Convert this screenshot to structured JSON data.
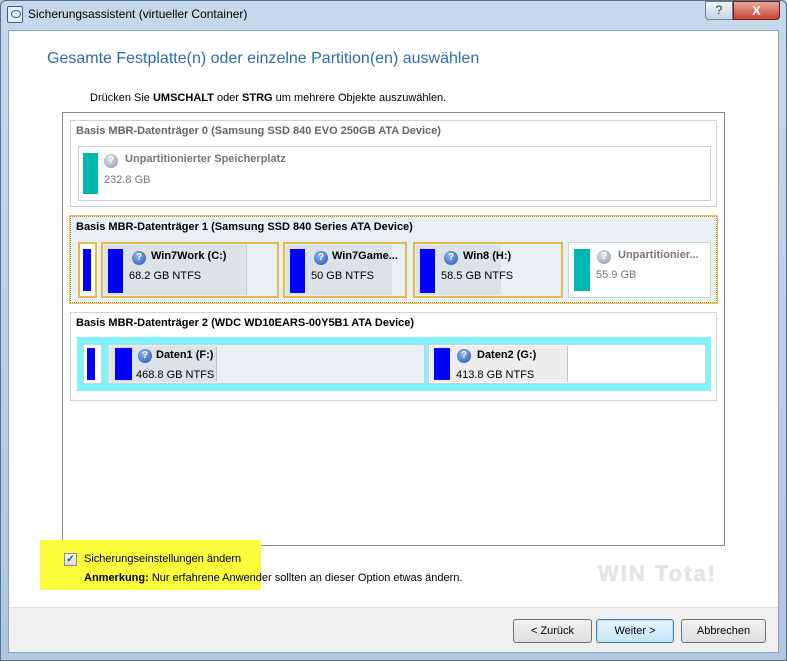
{
  "window": {
    "title": "Sicherungsassistent (virtueller Container)",
    "help": "?",
    "close": "X"
  },
  "heading": "Gesamte Festplatte(n) oder einzelne Partition(en) auswählen",
  "instruction": {
    "pre": "Drücken Sie ",
    "k1": "UMSCHALT",
    "mid": " oder ",
    "k2": "STRG",
    "post": " um mehrere Objekte auszuwählen."
  },
  "disks": [
    {
      "header": "Basis MBR-Datenträger 0 (Samsung SSD 840 EVO 250GB ATA Device)",
      "partitions": [
        {
          "name": "Unpartitionierter Speicherplatz",
          "size": "232.8 GB"
        }
      ]
    },
    {
      "header": "Basis MBR-Datenträger 1 (Samsung SSD 840 Series ATA Device)",
      "partitions": [
        {
          "name": "Win7Work (C:)",
          "size": "68.2 GB NTFS"
        },
        {
          "name": "Win7Game...",
          "size": "50 GB NTFS"
        },
        {
          "name": "Win8 (H:)",
          "size": "58.5 GB NTFS"
        },
        {
          "name": "Unpartitionier...",
          "size": "55.9 GB"
        }
      ]
    },
    {
      "header": "Basis MBR-Datenträger 2 (WDC WD10EARS-00Y5B1 ATA Device)",
      "partitions": [
        {
          "name": "Daten1 (F:)",
          "size": "468.8 GB NTFS"
        },
        {
          "name": "Daten2 (G:)",
          "size": "413.8 GB NTFS"
        }
      ]
    }
  ],
  "option": {
    "label": "Sicherungseinstellungen ändern",
    "checked": true,
    "note_label": "Anmerkung:",
    "note": " Nur erfahrene Anwender sollten an dieser Option etwas ändern."
  },
  "watermark": "WIN Tota!",
  "buttons": {
    "back": "< Zurück",
    "next": "Weiter >",
    "cancel": "Abbrechen"
  },
  "colors": {
    "primary_partition": "#0000ff",
    "unallocated": "#00b8b0",
    "selected_border": "#e8b84a",
    "disk2_band": "#80f4f8",
    "highlight": "#fbfd3c"
  }
}
